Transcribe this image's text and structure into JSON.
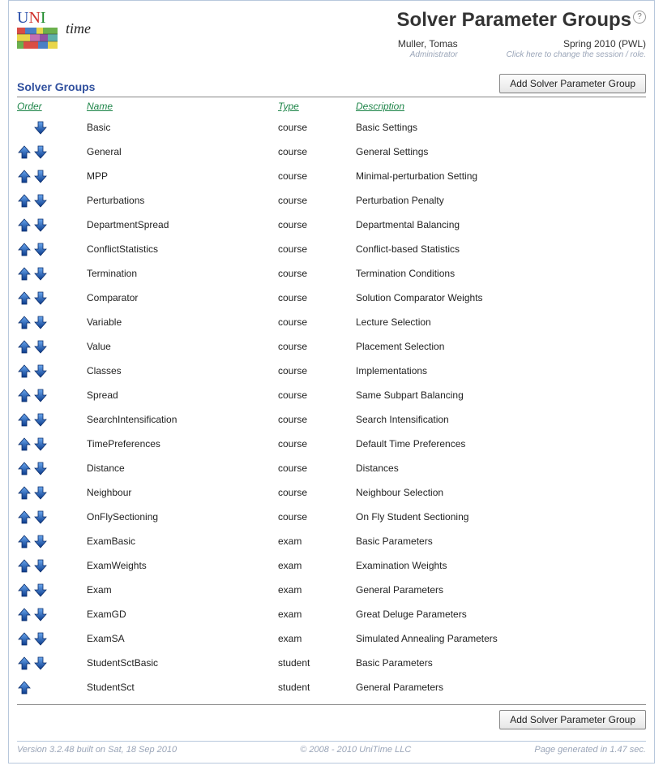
{
  "page_title": "Solver Parameter Groups",
  "user": {
    "name": "Muller, Tomas",
    "role": "Administrator",
    "session": "Spring 2010 (PWL)",
    "session_hint": "Click here to change the session / role."
  },
  "section_title": "Solver Groups",
  "add_button_label": "Add Solver Parameter Group",
  "columns": {
    "order": "Order",
    "name": "Name",
    "type": "Type",
    "description": "Description"
  },
  "rows": [
    {
      "up": false,
      "down": true,
      "name": "Basic",
      "type": "course",
      "description": "Basic Settings"
    },
    {
      "up": true,
      "down": true,
      "name": "General",
      "type": "course",
      "description": "General Settings"
    },
    {
      "up": true,
      "down": true,
      "name": "MPP",
      "type": "course",
      "description": "Minimal-perturbation Setting"
    },
    {
      "up": true,
      "down": true,
      "name": "Perturbations",
      "type": "course",
      "description": "Perturbation Penalty"
    },
    {
      "up": true,
      "down": true,
      "name": "DepartmentSpread",
      "type": "course",
      "description": "Departmental Balancing"
    },
    {
      "up": true,
      "down": true,
      "name": "ConflictStatistics",
      "type": "course",
      "description": "Conflict-based Statistics"
    },
    {
      "up": true,
      "down": true,
      "name": "Termination",
      "type": "course",
      "description": "Termination Conditions"
    },
    {
      "up": true,
      "down": true,
      "name": "Comparator",
      "type": "course",
      "description": "Solution Comparator Weights"
    },
    {
      "up": true,
      "down": true,
      "name": "Variable",
      "type": "course",
      "description": "Lecture Selection"
    },
    {
      "up": true,
      "down": true,
      "name": "Value",
      "type": "course",
      "description": "Placement Selection"
    },
    {
      "up": true,
      "down": true,
      "name": "Classes",
      "type": "course",
      "description": "Implementations"
    },
    {
      "up": true,
      "down": true,
      "name": "Spread",
      "type": "course",
      "description": "Same Subpart Balancing"
    },
    {
      "up": true,
      "down": true,
      "name": "SearchIntensification",
      "type": "course",
      "description": "Search Intensification"
    },
    {
      "up": true,
      "down": true,
      "name": "TimePreferences",
      "type": "course",
      "description": "Default Time Preferences"
    },
    {
      "up": true,
      "down": true,
      "name": "Distance",
      "type": "course",
      "description": "Distances"
    },
    {
      "up": true,
      "down": true,
      "name": "Neighbour",
      "type": "course",
      "description": "Neighbour Selection"
    },
    {
      "up": true,
      "down": true,
      "name": "OnFlySectioning",
      "type": "course",
      "description": "On Fly Student Sectioning"
    },
    {
      "up": true,
      "down": true,
      "name": "ExamBasic",
      "type": "exam",
      "description": "Basic Parameters"
    },
    {
      "up": true,
      "down": true,
      "name": "ExamWeights",
      "type": "exam",
      "description": "Examination Weights"
    },
    {
      "up": true,
      "down": true,
      "name": "Exam",
      "type": "exam",
      "description": "General Parameters"
    },
    {
      "up": true,
      "down": true,
      "name": "ExamGD",
      "type": "exam",
      "description": "Great Deluge Parameters"
    },
    {
      "up": true,
      "down": true,
      "name": "ExamSA",
      "type": "exam",
      "description": "Simulated Annealing Parameters"
    },
    {
      "up": true,
      "down": true,
      "name": "StudentSctBasic",
      "type": "student",
      "description": "Basic Parameters"
    },
    {
      "up": true,
      "down": false,
      "name": "StudentSct",
      "type": "student",
      "description": "General Parameters"
    }
  ],
  "footer": {
    "left": "Version 3.2.48 built on Sat, 18 Sep 2010",
    "center": "© 2008 - 2010 UniTime LLC",
    "right": "Page generated in 1.47 sec."
  }
}
